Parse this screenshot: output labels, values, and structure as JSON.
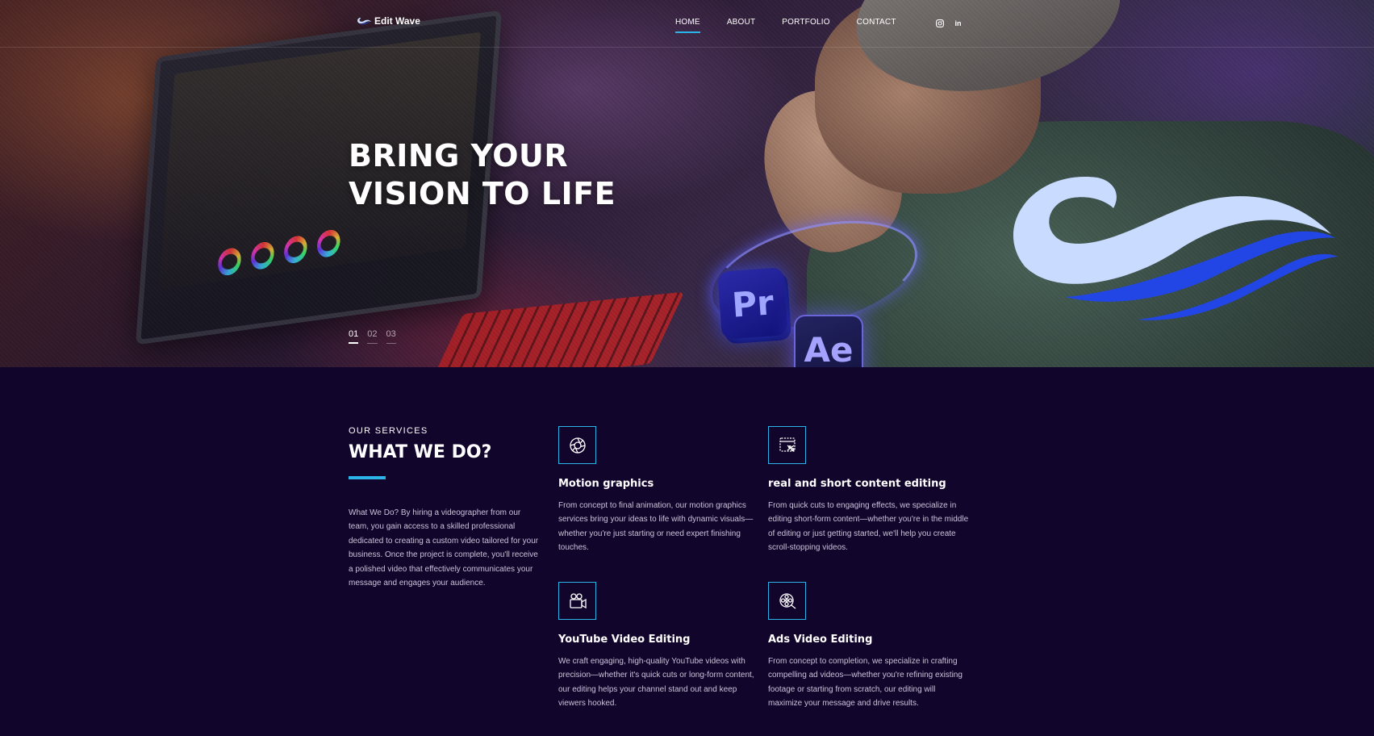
{
  "header": {
    "brand_name": "Edit Wave",
    "nav": [
      {
        "label": "HOME"
      },
      {
        "label": "ABOUT"
      },
      {
        "label": "PORTFOLIO"
      },
      {
        "label": "CONTACT"
      }
    ],
    "social": [
      {
        "icon": "instagram-icon"
      },
      {
        "icon": "linkedin-icon",
        "glyph": "in"
      }
    ],
    "accent_color": "#2ab4e8"
  },
  "hero": {
    "title_line1": "BRING YOUR",
    "title_line2": "VISION TO LIFE",
    "slides": [
      "01",
      "02",
      "03"
    ],
    "active_slide": "01",
    "badges": {
      "premiere": "Pr",
      "after_effects": "Ae"
    }
  },
  "services": {
    "eyebrow": "OUR SERVICES",
    "title": "WHAT WE DO?",
    "intro": "What We Do? By hiring a videographer from our team, you gain access to a skilled professional dedicated to creating a custom video tailored for your business. Once the project is complete, you'll receive a polished video that effectively communicates your message and engages your audience.",
    "items": [
      {
        "icon": "aperture-icon",
        "title": "Motion graphics",
        "text": "From concept to final animation, our motion graphics services bring your ideas to life with dynamic visuals—whether you're just starting or need expert finishing touches."
      },
      {
        "icon": "video-edit-icon",
        "title": "real and short content editing",
        "text": "From quick cuts to engaging effects, we specialize in editing short-form content—whether you're in the middle of editing or just getting started, we'll help you create scroll-stopping videos."
      },
      {
        "icon": "video-camera-icon",
        "title": "YouTube Video Editing",
        "text": "We craft engaging, high-quality YouTube videos with precision—whether it's quick cuts or long-form content, our editing helps your channel stand out and keep viewers hooked."
      },
      {
        "icon": "film-reel-icon",
        "title": "Ads Video Editing",
        "text": "From concept to completion, we specialize in crafting compelling ad videos—whether you're refining existing footage or starting from scratch, our editing will maximize your message and drive results."
      }
    ]
  }
}
